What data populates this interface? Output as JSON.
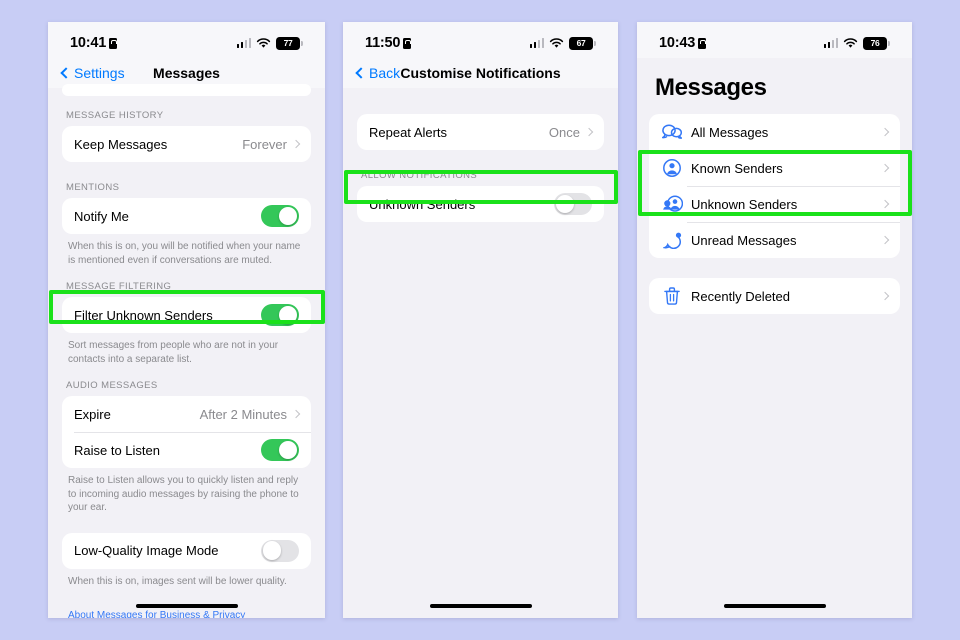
{
  "background_color": "#c8cdf5",
  "accent_colors": {
    "blue": "#007aff",
    "green_toggle": "#34c759",
    "highlight_green": "#1ae11a",
    "link": "#3478f6"
  },
  "phones": [
    {
      "id": "messages-settings",
      "status": {
        "time": "10:41",
        "battery": "77",
        "icons": [
          "cellular-icon",
          "wifi-icon",
          "battery-icon",
          "lock-icon"
        ]
      },
      "nav": {
        "back_label": "Settings",
        "title": "Messages"
      },
      "sections": [
        {
          "header": "MESSAGE HISTORY",
          "rows": [
            {
              "label": "Keep Messages",
              "value": "Forever",
              "type": "disclosure"
            }
          ],
          "footnote": ""
        },
        {
          "header": "MENTIONS",
          "rows": [
            {
              "label": "Notify Me",
              "type": "toggle",
              "state": "on"
            }
          ],
          "footnote": "When this is on, you will be notified when your name is mentioned even if conversations are muted."
        },
        {
          "header": "MESSAGE FILTERING",
          "rows": [
            {
              "label": "Filter Unknown Senders",
              "type": "toggle",
              "state": "on"
            }
          ],
          "footnote": "Sort messages from people who are not in your contacts into a separate list."
        },
        {
          "header": "AUDIO MESSAGES",
          "rows": [
            {
              "label": "Expire",
              "value": "After 2 Minutes",
              "type": "disclosure"
            },
            {
              "label": "Raise to Listen",
              "type": "toggle",
              "state": "on"
            }
          ],
          "footnote": "Raise to Listen allows you to quickly listen and reply to incoming audio messages by raising the phone to your ear."
        },
        {
          "header": "",
          "rows": [
            {
              "label": "Low-Quality Image Mode",
              "type": "toggle",
              "state": "off"
            }
          ],
          "footnote": "When this is on, images sent will be lower quality."
        }
      ],
      "link": "About Messages for Business & Privacy"
    },
    {
      "id": "customise-notifications",
      "status": {
        "time": "11:50",
        "battery": "67",
        "icons": [
          "cellular-icon",
          "wifi-icon",
          "battery-icon",
          "lock-icon"
        ]
      },
      "nav": {
        "back_label": "Back",
        "title": "Customise Notifications"
      },
      "sections": [
        {
          "header": "",
          "rows": [
            {
              "label": "Repeat Alerts",
              "value": "Once",
              "type": "disclosure"
            }
          ],
          "footnote": ""
        },
        {
          "header": "ALLOW NOTIFICATIONS",
          "rows": [
            {
              "label": "Unknown Senders",
              "type": "toggle",
              "state": "off"
            }
          ],
          "footnote": ""
        }
      ]
    },
    {
      "id": "messages-filters",
      "status": {
        "time": "10:43",
        "battery": "76",
        "icons": [
          "cellular-icon",
          "wifi-icon",
          "battery-icon",
          "lock-icon"
        ]
      },
      "title": "Messages",
      "groups": [
        {
          "rows": [
            {
              "label": "All Messages",
              "icon": "speech-bubbles-icon"
            },
            {
              "label": "Known Senders",
              "icon": "person-circle-icon"
            },
            {
              "label": "Unknown Senders",
              "icon": "two-people-icon"
            },
            {
              "label": "Unread Messages",
              "icon": "unread-bubble-icon"
            }
          ]
        },
        {
          "rows": [
            {
              "label": "Recently Deleted",
              "icon": "trash-icon"
            }
          ]
        }
      ]
    }
  ],
  "highlights": [
    {
      "target": "Filter Unknown Senders row"
    },
    {
      "target": "Unknown Senders notification toggle row"
    },
    {
      "target": "Known Senders and Unknown Senders rows"
    }
  ]
}
